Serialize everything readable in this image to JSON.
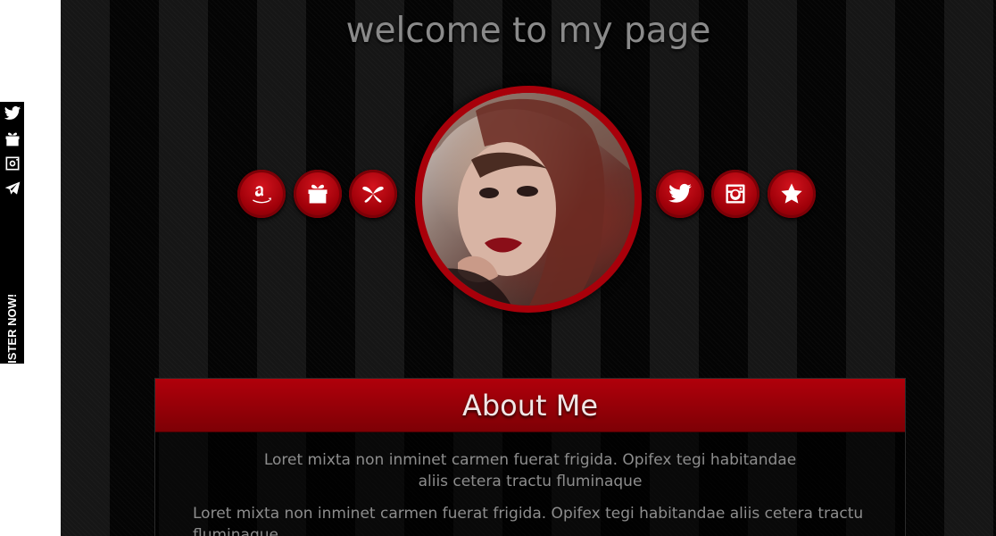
{
  "page": {
    "title": "welcome to my page"
  },
  "sidebar": {
    "register_text": "NO ACCOUNT? REGISTER NOW!",
    "icons": [
      "twitter-icon",
      "gift-icon",
      "instagram-icon",
      "telegram-icon"
    ]
  },
  "social": {
    "left": [
      "amazon-icon",
      "gift-icon",
      "chaturbate-icon"
    ],
    "right": [
      "twitter-icon",
      "instagram-icon",
      "star-icon"
    ]
  },
  "about": {
    "title": "About Me",
    "paragraph1": "Loret mixta non inminet carmen fuerat frigida. Opifex tegi habitandae aliis cetera tractu fluminaque",
    "paragraph2": "Loret mixta non inminet carmen fuerat frigida. Opifex tegi habitandae aliis cetera tractu fluminaque"
  },
  "colors": {
    "accent_red": "#a8000a",
    "title_gray": "#8a8a8a",
    "text_gray": "#8d8d8d"
  }
}
